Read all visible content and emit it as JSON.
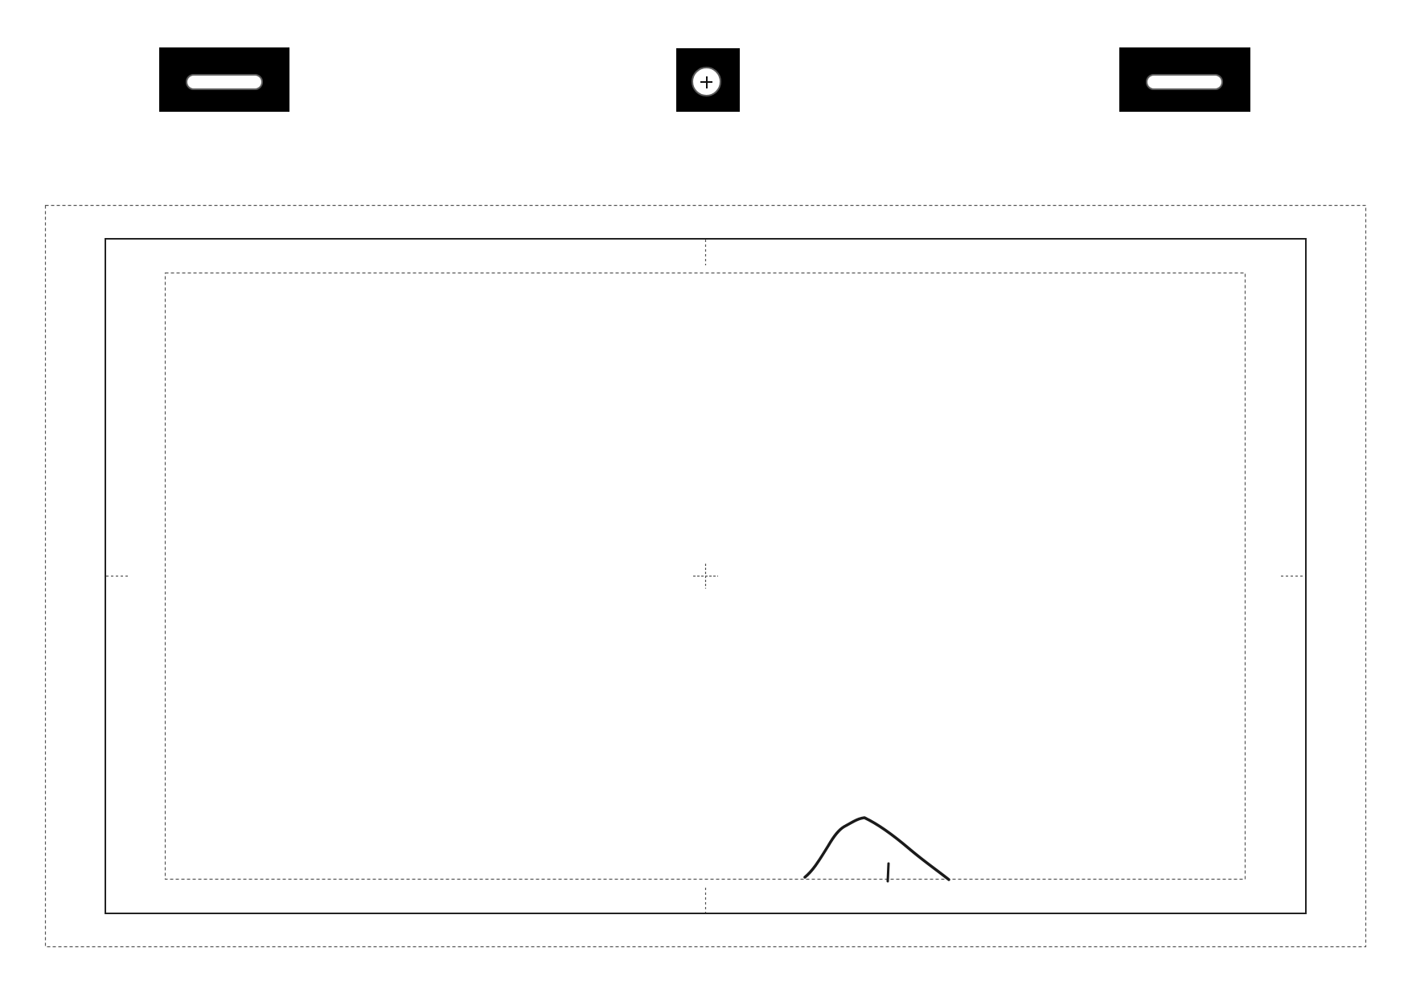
{
  "template": {
    "registration_marks": {
      "left_punch": "slot-punch-icon",
      "center_punch": "plus-punch-icon",
      "right_punch": "slot-punch-icon"
    },
    "frames": {
      "outer_margin": "dashed-guide",
      "page_border": "solid-border",
      "safe_area": "dashed-guide"
    },
    "center_mark": "crosshair-icon",
    "sketch": {
      "content": "mountain-sketch"
    }
  },
  "colors": {
    "ink": "#000000",
    "paper": "#ffffff",
    "guide": "#555555",
    "border": "#222222"
  }
}
